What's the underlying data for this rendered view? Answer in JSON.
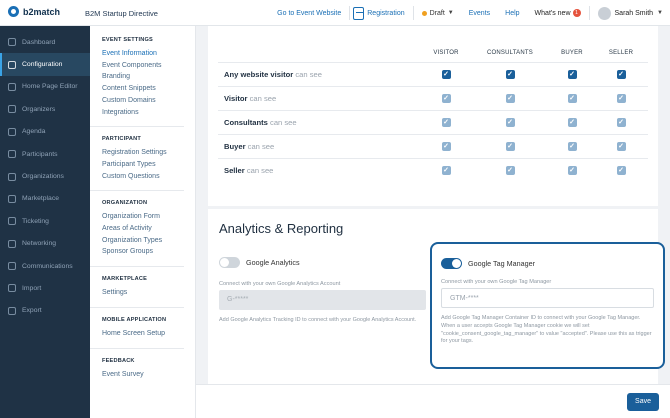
{
  "topbar": {
    "logo": "b2match",
    "event_name": "B2M Startup Directive",
    "goto_event": "Go to Event Website",
    "registration": "Registration",
    "status": "Draft",
    "events": "Events",
    "help": "Help",
    "whats_new": "What's new",
    "whats_new_count": "1",
    "user": "Sarah Smith",
    "colors": {
      "status_dot": "#f0a020",
      "badge": "#e5533d",
      "link": "#1a6fb5"
    }
  },
  "sidebar": {
    "items": [
      {
        "label": "Dashboard",
        "icon": "dashboard-icon"
      },
      {
        "label": "Configuration",
        "icon": "gear-icon",
        "active": true
      },
      {
        "label": "Home Page Editor",
        "icon": "page-icon"
      },
      {
        "label": "Organizers",
        "icon": "users-icon"
      },
      {
        "label": "Agenda",
        "icon": "calendar-icon"
      },
      {
        "label": "Participants",
        "icon": "participants-icon"
      },
      {
        "label": "Organizations",
        "icon": "building-icon"
      },
      {
        "label": "Marketplace",
        "icon": "store-icon"
      },
      {
        "label": "Ticketing",
        "icon": "ticket-icon"
      },
      {
        "label": "Networking",
        "icon": "network-icon"
      },
      {
        "label": "Communications",
        "icon": "chat-icon"
      },
      {
        "label": "Import",
        "icon": "import-icon"
      },
      {
        "label": "Export",
        "icon": "export-icon"
      }
    ],
    "colors": {
      "bg": "#1f3245",
      "active_bg": "#284861"
    }
  },
  "settings_nav": {
    "sections": [
      {
        "heading": "EVENT SETTINGS",
        "links": [
          "Event Information",
          "Event Components",
          "Branding",
          "Content Snippets",
          "Custom Domains",
          "Integrations"
        ]
      },
      {
        "heading": "PARTICIPANT",
        "links": [
          "Registration Settings",
          "Participant Types",
          "Custom Questions"
        ]
      },
      {
        "heading": "ORGANIZATION",
        "links": [
          "Organization Form",
          "Areas of Activity",
          "Organization Types",
          "Sponsor Groups"
        ]
      },
      {
        "heading": "MARKETPLACE",
        "links": [
          "Settings"
        ]
      },
      {
        "heading": "MOBILE APPLICATION",
        "links": [
          "Home Screen Setup"
        ]
      },
      {
        "heading": "FEEDBACK",
        "links": [
          "Event Survey"
        ]
      }
    ]
  },
  "visibility": {
    "columns": [
      "VISITOR",
      "CONSULTANTS",
      "BUYER",
      "SELLER"
    ],
    "rows": [
      {
        "label": "Any website visitor",
        "suffix": "can see",
        "enabled": true
      },
      {
        "label": "Visitor",
        "suffix": "can see",
        "enabled": false
      },
      {
        "label": "Consultants",
        "suffix": "can see",
        "enabled": false
      },
      {
        "label": "Buyer",
        "suffix": "can see",
        "enabled": false
      },
      {
        "label": "Seller",
        "suffix": "can see",
        "enabled": false
      }
    ]
  },
  "analytics": {
    "title": "Analytics & Reporting",
    "ga": {
      "toggle_label": "Google Analytics",
      "toggle_on": false,
      "field_label": "Connect with your own Google Analytics Account",
      "placeholder": "G-*****",
      "help": "Add Google Analytics Tracking ID to connect with your Google Analytics Account."
    },
    "gtm": {
      "toggle_label": "Google Tag Manager",
      "toggle_on": true,
      "field_label": "Connect with your own Google Tag Manager",
      "placeholder": "GTM-****",
      "help": "Add Google Tag Manager Container ID to connect with your Google Tag Manager. When a user accepts Google Tag Manager cookie we will set \"cookie_consent_google_tag_manager\" to value \"accepted\". Please use this as trigger for your tags."
    }
  },
  "footer": {
    "save_label": "Save"
  }
}
